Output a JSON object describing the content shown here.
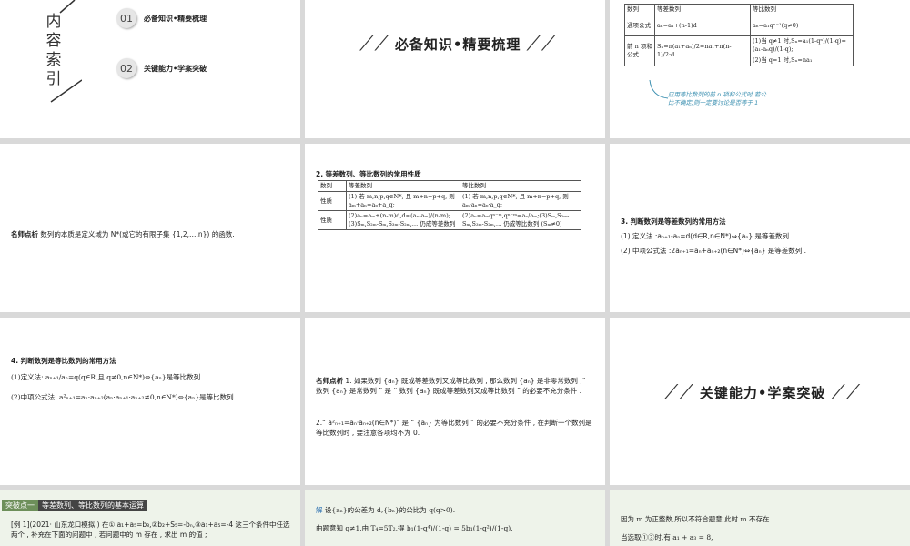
{
  "slide1": {
    "vertical_title": [
      "内",
      "容",
      "索",
      "引"
    ],
    "items": [
      {
        "num": "01",
        "label": "必备知识•精要梳理"
      },
      {
        "num": "02",
        "label": "关键能力•学案突破"
      }
    ]
  },
  "slide2": {
    "banner": "必备知识•精要梳理"
  },
  "slide3": {
    "headers": [
      "数列",
      "等差数列",
      "等比数列"
    ],
    "row1": {
      "label": "通项公式",
      "arith": "aₙ=a₁+(n-1)d",
      "geo": "aₙ=a₁qⁿ⁻¹(q≠0)"
    },
    "row2": {
      "label": "前 n 项和公式",
      "arith": "Sₙ=n(a₁+aₙ)/2=na₁+n(n-1)/2·d",
      "geo1": "(1)当 q≠1 时,Sₙ=a₁(1-qⁿ)/(1-q)=(a₁-aₙq)/(1-q);",
      "geo2": "(2)当 q=1 时,Sₙ=na₁"
    },
    "note": "应用等比数列的前 n 项和公式时,若公比不确定,则一定要讨论是否等于 1"
  },
  "slide4": {
    "label": "名师点析",
    "text": "数列的本质是定义域为 N*(或它的有限子集 {1,2,…,n}) 的函数."
  },
  "slide5": {
    "title": "2. 等差数列、等比数列的常用性质",
    "headers": [
      "数列",
      "等差数列",
      "等比数列"
    ],
    "row1": {
      "label": "性质",
      "arith": "(1) 若 m,n,p,q∈N*, 且 m+n=p+q, 则 aₘ+aₙ=aₚ+a_q;",
      "geo": "(1) 若 m,n,p,q∈N*, 且 m+n=p+q, 则 aₘ·aₙ=aₚ·a_q;"
    },
    "row2": {
      "label": "性质",
      "arith": "(2)aₙ=aₘ+(n-m)d,d=(aₙ-aₘ)/(n-m);(3)Sₘ,S₂ₘ-Sₘ,S₃ₘ-S₂ₘ,… 仍成等差数列",
      "geo": "(2)aₙ=aₘqⁿ⁻ᵐ,qⁿ⁻ᵐ=aₙ/aₘ;(3)Sₘ,S₂ₘ-Sₘ,S₃ₘ-S₂ₘ,… 仍成等比数列 (Sₘ≠0)"
    }
  },
  "slide6": {
    "title": "3. 判断数列是等差数列的常用方法",
    "line1": "(1) 定义法 :aₙ₊₁-aₙ=d(d∈R,n∈N*)⇔{aₙ} 是等差数列 .",
    "line2": "(2) 中项公式法 :2aₙ₊₁=aₙ+aₙ₊₂(n∈N*)⇔{aₙ} 是等差数列 ."
  },
  "slide7": {
    "title": "4. 判断数列是等比数列的常用方法",
    "line1": "(1)定义法: aₙ₊₁/aₙ=q(q∈R,且 q≠0,n∈N*)⇔{aₙ}是等比数列.",
    "line2": "(2)中项公式法: a²ₙ₊₁=aₙ·aₙ₊₂(aₙ·aₙ₊₁·aₙ₊₂≠0,n∈N*)⇔{aₙ}是等比数列."
  },
  "slide8": {
    "label": "名师点析",
    "p1": "1. 如果数列 {aₙ} 既成等差数列又成等比数列 , 那么数列 {aₙ} 是非零常数列 ;“ 数列 {aₙ} 是常数列 ” 是 “ 数列 {aₙ} 既成等差数列又成等比数列 ” 的必要不充分条件 .",
    "p2": "2.“ a²ₙ₊₁=aₙ·aₙ₊₂(n∈N*)” 是 “ {aₙ} 为等比数列 ” 的必要不充分条件 , 在判断一个数列是等比数列时 , 要注意各项均不为 0."
  },
  "slide9": {
    "banner": "关键能力•学案突破"
  },
  "slide10": {
    "tag1": "突破点一",
    "tag2": "等差数列、等比数列的基本运算",
    "text": "[例 1](2021· 山东龙口模拟 ) 在① a₁+a₅=b₃,②b₂+S₅=-bₙ,③a₁+a₅=-4 这三个条件中任选两个 , 补充在下面的问题中 , 若问题中的 m 存在 , 求出 m 的值 ;"
  },
  "slide11": {
    "label": "解",
    "line1": "设{aₙ}的公差为 d,{bₙ}的公比为 q(q>0).",
    "line2": "由题意知 q≠1,由 T₄=5T₂,得 b₁(1-q⁴)/(1-q) = 5b₁(1-q²)/(1-q),"
  },
  "slide12": {
    "line1": "因为 m 为正整数,所以不符合题意,此时 m 不存在.",
    "line2": "当选取①③时,有 a₁ + a₃ = 8,"
  }
}
